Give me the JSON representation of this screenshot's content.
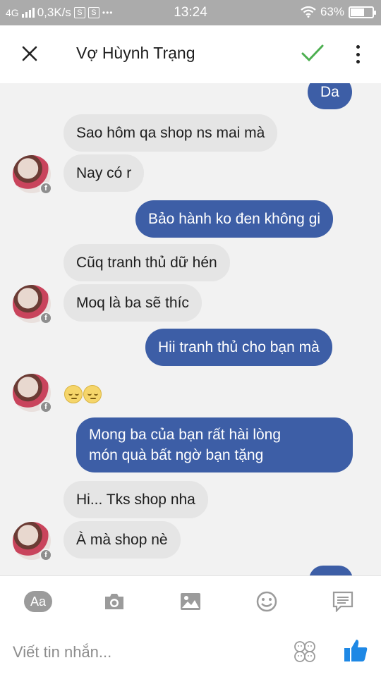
{
  "status_bar": {
    "network": "4G",
    "speed": "0,3K/s",
    "icon_s1": "S",
    "icon_s2": "S",
    "dots": "•••",
    "time": "13:24",
    "battery": "63%",
    "battery_level": 0.63
  },
  "header": {
    "title": "Vợ Hùynh Trạng",
    "check_color": "#4caf50"
  },
  "messages": [
    {
      "dir": "out",
      "text": "Da"
    },
    {
      "dir": "in",
      "text": "Sao hôm qa shop ns mai mà"
    },
    {
      "dir": "in",
      "text": "Nay có r"
    },
    {
      "dir": "out",
      "text": "Bảo hành ko đen không gi"
    },
    {
      "dir": "in",
      "text": "Cũq tranh thủ dữ hén"
    },
    {
      "dir": "in",
      "text": "Moq là ba sẽ thíc"
    },
    {
      "dir": "out",
      "text": "Hii tranh thủ cho bạn mà"
    },
    {
      "dir": "in",
      "text": "emoji-pensive-x2"
    },
    {
      "dir": "out",
      "text": "Mong ba của bạn rất hài lòng"
    },
    {
      "dir": "out",
      "text": "món quà bất ngờ bạn tặng"
    },
    {
      "dir": "in",
      "text": "Hi... Tks shop nha"
    },
    {
      "dir": "in",
      "text": "À mà shop nè"
    }
  ],
  "composer": {
    "aa_label": "Aa",
    "placeholder": "Viết tin nhắn...",
    "accent_color": "#1e88e5"
  },
  "colors": {
    "outgoing_bubble": "#3d5ea6",
    "incoming_bubble": "#e5e5e5"
  }
}
